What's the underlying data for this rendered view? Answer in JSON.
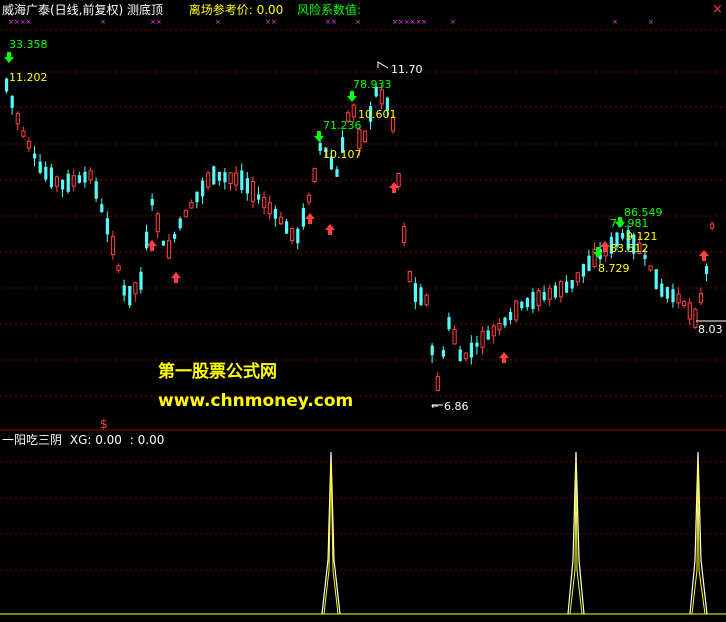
{
  "header": {
    "stock_title": "威海广泰(日线,前复权)",
    "indicator_name": "测底顶",
    "exit_ref_label": "离场参考价:",
    "exit_ref_value": "0.00",
    "risk_label": "风险系数值:",
    "close_label": "×"
  },
  "watermark": {
    "line1": "第一股票公式网",
    "line2": "www.chnmoney.com"
  },
  "price_labels": {
    "high_left": "33.358",
    "p_left": "11.202",
    "peak_top": "11.70",
    "g1": "78.933",
    "g2": "10.601",
    "g3": "71.236",
    "g4": "10.107",
    "bottom": "6.86",
    "r1": "86.549",
    "r2": "79.981",
    "r3": "9.121",
    "r4": "83.512",
    "r5": "8.729",
    "right_edge": "8.03"
  },
  "lower_panel": {
    "title": "一阳吃三阴",
    "xg_label": "XG: 0.00",
    "xg_value2": ": 0.00",
    "marker": "$"
  },
  "colors": {
    "up": "#ff4040",
    "down": "#54fcfc",
    "grid": "#800000",
    "yellow": "#ffff00",
    "green": "#00ff00",
    "magenta": "#ff40ff",
    "white": "#ffffff"
  }
}
